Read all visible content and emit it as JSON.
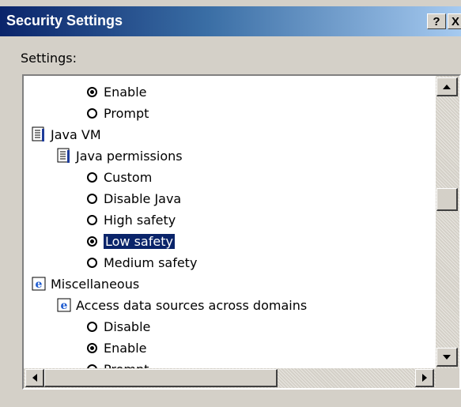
{
  "window": {
    "title": "Security Settings",
    "help_button": "?",
    "close_button": "X"
  },
  "settings_label": "Settings:",
  "tree": {
    "items": [
      {
        "label": "Enable",
        "type": "radio",
        "checked": true
      },
      {
        "label": "Prompt",
        "type": "radio",
        "checked": false
      },
      {
        "label": "Java VM",
        "type": "category",
        "icon": "document-icon"
      },
      {
        "label": "Java permissions",
        "type": "subcategory",
        "icon": "document-icon"
      },
      {
        "label": "Custom",
        "type": "radio",
        "checked": false
      },
      {
        "label": "Disable Java",
        "type": "radio",
        "checked": false
      },
      {
        "label": "High safety",
        "type": "radio",
        "checked": false
      },
      {
        "label": "Low safety",
        "type": "radio",
        "checked": true,
        "selected": true
      },
      {
        "label": "Medium safety",
        "type": "radio",
        "checked": false
      },
      {
        "label": "Miscellaneous",
        "type": "category",
        "icon": "internet-explorer-icon"
      },
      {
        "label": "Access data sources across domains",
        "type": "subcategory",
        "icon": "internet-explorer-icon"
      },
      {
        "label": "Disable",
        "type": "radio",
        "checked": false
      },
      {
        "label": "Enable",
        "type": "radio",
        "checked": true
      },
      {
        "label": "Prompt",
        "type": "radio",
        "checked": false
      }
    ]
  },
  "colors": {
    "title_bar_start": "#0a246a",
    "title_bar_end": "#a6caf0",
    "selection": "#0a246a",
    "dialog_face": "#d4d0c8"
  }
}
